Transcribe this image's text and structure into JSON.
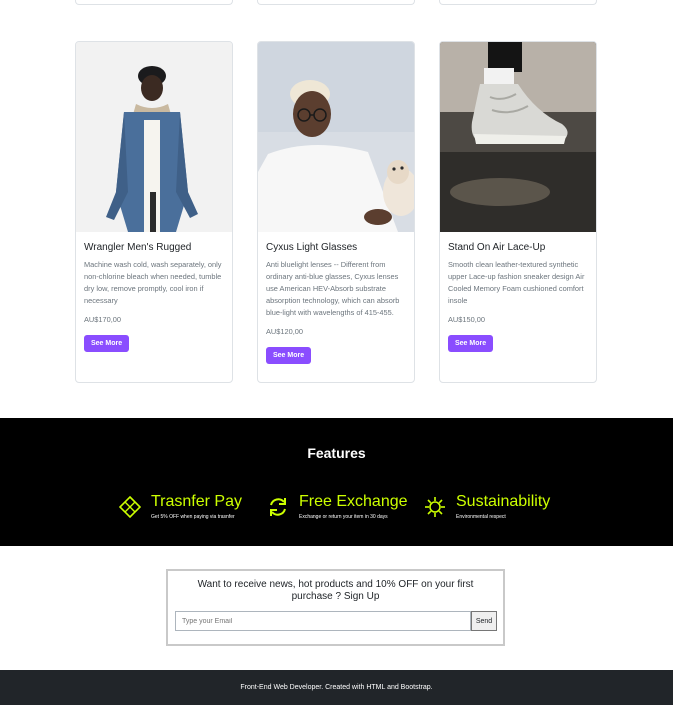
{
  "products": [
    {
      "title": "Wrangler Men's Rugged",
      "description": "Machine wash cold, wash separately, only non-chlorine bleach when needed, tumble dry low, remove promptly, cool iron if necessary",
      "price": "AU$170,00",
      "button": "See More"
    },
    {
      "title": "Cyxus Light Glasses",
      "description": "Anti bluelight lenses -- Different from ordinary anti-blue glasses, Cyxus lenses use American HEV-Absorb substrate absorption technology, which can absorb blue-light with wavelengths of 415-455.",
      "price": "AU$120,00",
      "button": "See More"
    },
    {
      "title": "Stand On Air Lace-Up",
      "description": "Smooth clean leather-textured synthetic upper Lace-up fashion sneaker design Air Cooled Memory Foam cushioned comfort insole",
      "price": "AU$150,00",
      "button": "See More"
    }
  ],
  "features": {
    "title": "Features",
    "items": [
      {
        "name": "Trasnfer Pay",
        "desc": "Get 5% OFF when paying via trasnfer",
        "icon": "diamond-icon"
      },
      {
        "name": "Free Exchange",
        "desc": "Exchange or return your item in 30 days",
        "icon": "exchange-arrows-icon"
      },
      {
        "name": "Sustainability",
        "desc": "Environmental respect",
        "icon": "sun-icon"
      }
    ],
    "accent_color": "#ccff00"
  },
  "newsletter": {
    "text": "Want to receive news, hot products and 10% OFF on your first purchase ? Sign Up",
    "placeholder": "Type your Email",
    "send_label": "Send"
  },
  "footer": {
    "text": "Front-End Web Developer. Created with HTML and Bootstrap."
  },
  "colors": {
    "button": "#8a4dff",
    "features_bg": "#000000",
    "footer_bg": "#212529"
  }
}
